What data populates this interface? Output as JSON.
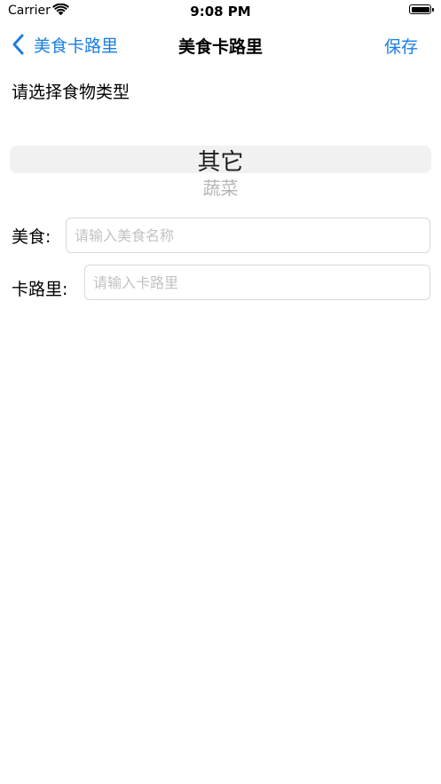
{
  "status_bar": {
    "carrier": "Carrier",
    "time": "9:08 PM"
  },
  "nav": {
    "back_label": "美食卡路里",
    "title": "美食卡路里",
    "save_label": "保存"
  },
  "form": {
    "prompt": "请选择食物类型",
    "picker": {
      "selected": "其它",
      "next": "蔬菜"
    },
    "food_label": "美食:",
    "food_placeholder": "请输入美食名称",
    "calorie_label": "卡路里:",
    "calorie_placeholder": "请输入卡路里"
  },
  "colors": {
    "accent": "#1a7ee0"
  }
}
